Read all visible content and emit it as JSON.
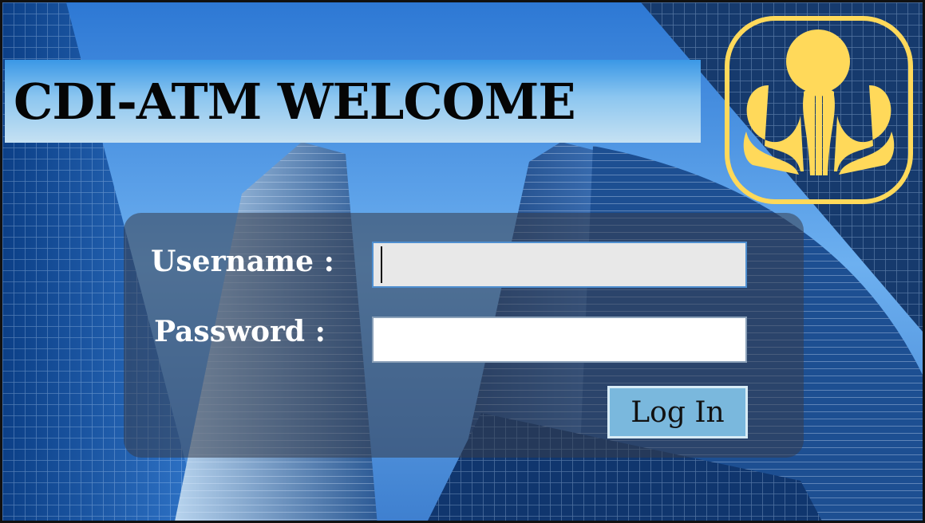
{
  "window": {
    "title": "CDI-ATM WELCOME"
  },
  "login": {
    "username_label": "Username :",
    "password_label": "Password  :",
    "username_value": "",
    "password_value": "",
    "login_button": "Log In"
  },
  "colors": {
    "title_bar": "#8cc6f0",
    "logo": "#ffd95a",
    "panel": "#373c4b",
    "button": "#7ab8dd"
  },
  "icons": {
    "logo": "bank-logo-icon"
  }
}
